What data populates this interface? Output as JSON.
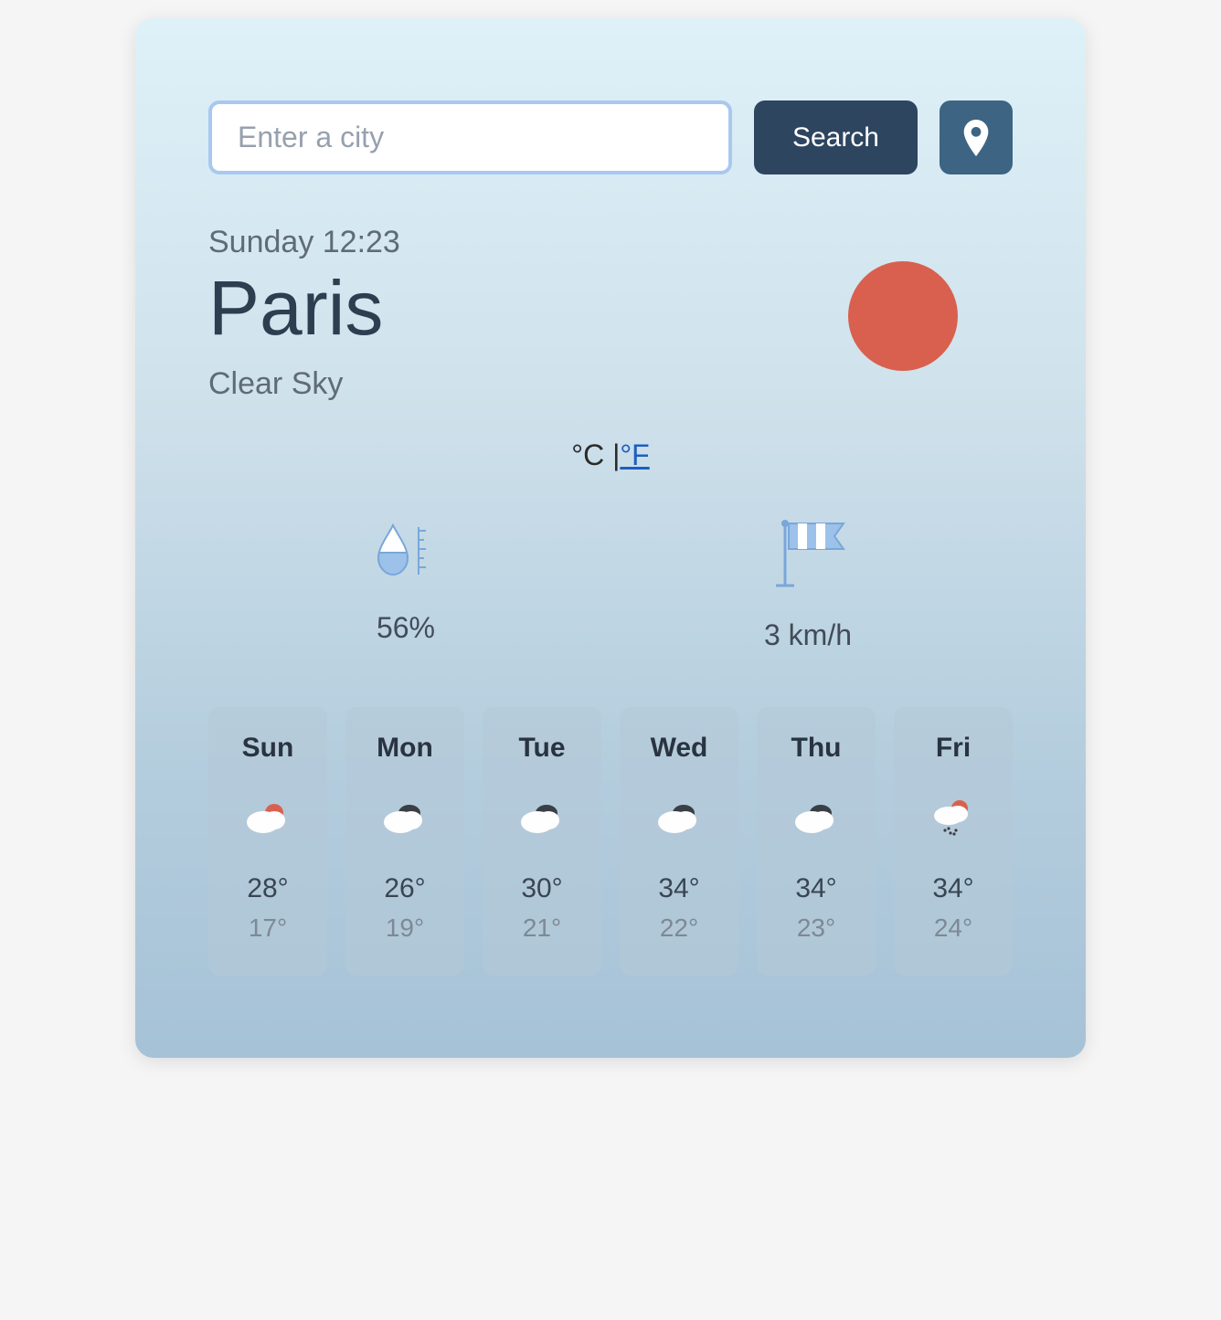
{
  "search": {
    "placeholder": "Enter a city",
    "button_label": "Search"
  },
  "current": {
    "datetime": "Sunday 12:23",
    "city": "Paris",
    "description": "Clear Sky",
    "icon": "clear-day"
  },
  "units": {
    "celsius_label": "°C",
    "separator": " |",
    "fahrenheit_label": "°F"
  },
  "metrics": {
    "humidity": "56%",
    "wind": "3 km/h"
  },
  "forecast": [
    {
      "day": "Sun",
      "icon": "partly-cloudy",
      "high": "28°",
      "low": "17°"
    },
    {
      "day": "Mon",
      "icon": "cloudy",
      "high": "26°",
      "low": "19°"
    },
    {
      "day": "Tue",
      "icon": "cloudy",
      "high": "30°",
      "low": "21°"
    },
    {
      "day": "Wed",
      "icon": "cloudy",
      "high": "34°",
      "low": "22°"
    },
    {
      "day": "Thu",
      "icon": "cloudy",
      "high": "34°",
      "low": "23°"
    },
    {
      "day": "Fri",
      "icon": "rain",
      "high": "34°",
      "low": "24°"
    }
  ],
  "colors": {
    "accent": "#d9604e",
    "dark": "#2e4560",
    "link": "#1b5fbf"
  }
}
